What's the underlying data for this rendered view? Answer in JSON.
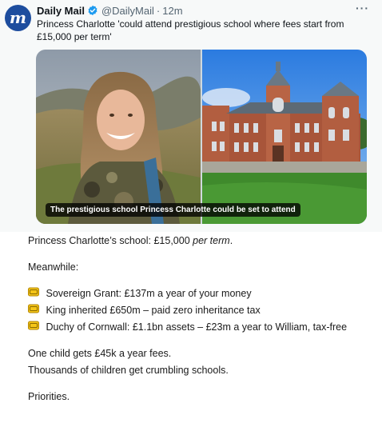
{
  "tweet": {
    "author_name": "Daily Mail",
    "handle": "@DailyMail",
    "separator": "·",
    "time": "12m",
    "more_label": "···",
    "avatar_letter": "m",
    "text": "Princess Charlotte 'could attend prestigious school where fees start from £15,000 per term'",
    "image_caption": "The prestigious school Princess Charlotte could be set to attend",
    "verified_color": "#1d9bf0",
    "avatar_color": "#1d4d9e",
    "media": [
      {
        "icon": "portrait-photo"
      },
      {
        "icon": "school-building-photo"
      }
    ]
  },
  "post": {
    "line1_prefix": "Princess Charlotte’s school: £15,000 ",
    "line1_emphasis": "per term",
    "line1_suffix": ".",
    "meanwhile": "Meanwhile:",
    "bullets": [
      {
        "icon": "money-bag-icon",
        "text": "Sovereign Grant: £137m a year of your money"
      },
      {
        "icon": "money-bag-icon",
        "text": "King inherited £650m – paid zero inheritance tax"
      },
      {
        "icon": "money-bag-icon",
        "text": "Duchy of Cornwall: £1.1bn assets – £23m a year to William, tax-free"
      }
    ],
    "contrast1": "One child gets £45k a year fees.",
    "contrast2": "Thousands of children get crumbling schools.",
    "closing": "Priorities."
  }
}
